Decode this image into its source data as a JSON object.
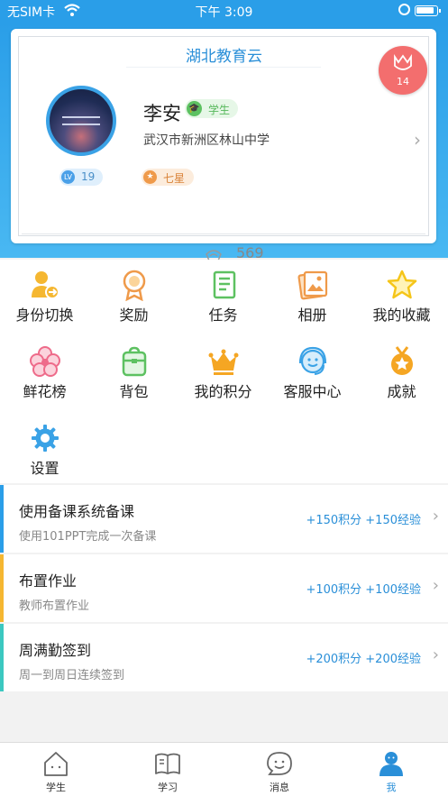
{
  "status_bar": {
    "carrier": "无SIM卡",
    "time": "下午 3:09"
  },
  "profile": {
    "platform_title": "湖北教育云",
    "name": "李安",
    "role": "学生",
    "school": "武汉市新洲区林山中学",
    "level": "19",
    "level_icon": "LV",
    "star_level": "七星",
    "likes": "569",
    "flowers": "14"
  },
  "menu": [
    {
      "label": "身份切换",
      "icon": "switch-identity-icon"
    },
    {
      "label": "奖励",
      "icon": "award-medal-icon"
    },
    {
      "label": "任务",
      "icon": "task-list-icon"
    },
    {
      "label": "相册",
      "icon": "photo-album-icon"
    },
    {
      "label": "我的收藏",
      "icon": "star-favorite-icon"
    },
    {
      "label": "鲜花榜",
      "icon": "flower-icon"
    },
    {
      "label": "背包",
      "icon": "backpack-icon"
    },
    {
      "label": "我的积分",
      "icon": "crown-icon"
    },
    {
      "label": "客服中心",
      "icon": "customer-service-icon"
    },
    {
      "label": "成就",
      "icon": "achievement-medal-icon"
    },
    {
      "label": "设置",
      "icon": "gear-icon"
    }
  ],
  "tasks": [
    {
      "title": "使用备课系统备课",
      "desc": "使用101PPT完成一次备课",
      "reward": "+150积分 +150经验",
      "accent": "#2a9ee8"
    },
    {
      "title": "布置作业",
      "desc": "教师布置作业",
      "reward": "+100积分 +100经验",
      "accent": "#f5b731"
    },
    {
      "title": "周满勤签到",
      "desc": "周一到周日连续签到",
      "reward": "+200积分 +200经验",
      "accent": "#3cc8c0"
    }
  ],
  "tab_bar": [
    {
      "label": "学生",
      "icon": "house-icon",
      "active": false
    },
    {
      "label": "学习",
      "icon": "book-icon",
      "active": false
    },
    {
      "label": "消息",
      "icon": "chat-bubble-icon",
      "active": false
    },
    {
      "label": "我",
      "icon": "person-icon",
      "active": true
    }
  ],
  "colors": {
    "brand_blue": "#2a9ee8",
    "role_green": "#5dc161",
    "star_orange": "#ef9a4a",
    "flower_red": "#f36e6e",
    "reward_blue": "#2a8fd8"
  }
}
